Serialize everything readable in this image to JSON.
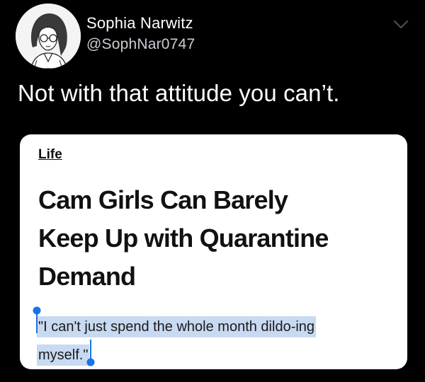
{
  "tweet": {
    "display_name": "Sophia Narwitz",
    "handle": "@SophNar0747",
    "text": "Not with that attitude you can’t."
  },
  "icons": {
    "avatar": "anime-girl-avatar-icon",
    "menu": "chevron-down-icon",
    "selection_start": "selection-handle-start-icon",
    "selection_end": "selection-handle-end-icon"
  },
  "card": {
    "section": "Life",
    "headline_lines": [
      "Cam Girls Can Barely",
      "Keep Up with Quarantine",
      "Demand"
    ],
    "quote_lines": [
      "\"I can't just spend the whole month dildo-ing",
      "myself.\""
    ]
  },
  "colors": {
    "background": "#000000",
    "handle": "#c7cdd3",
    "selection_highlight": "#c8daf1",
    "selection_handle": "#1a73e8"
  }
}
